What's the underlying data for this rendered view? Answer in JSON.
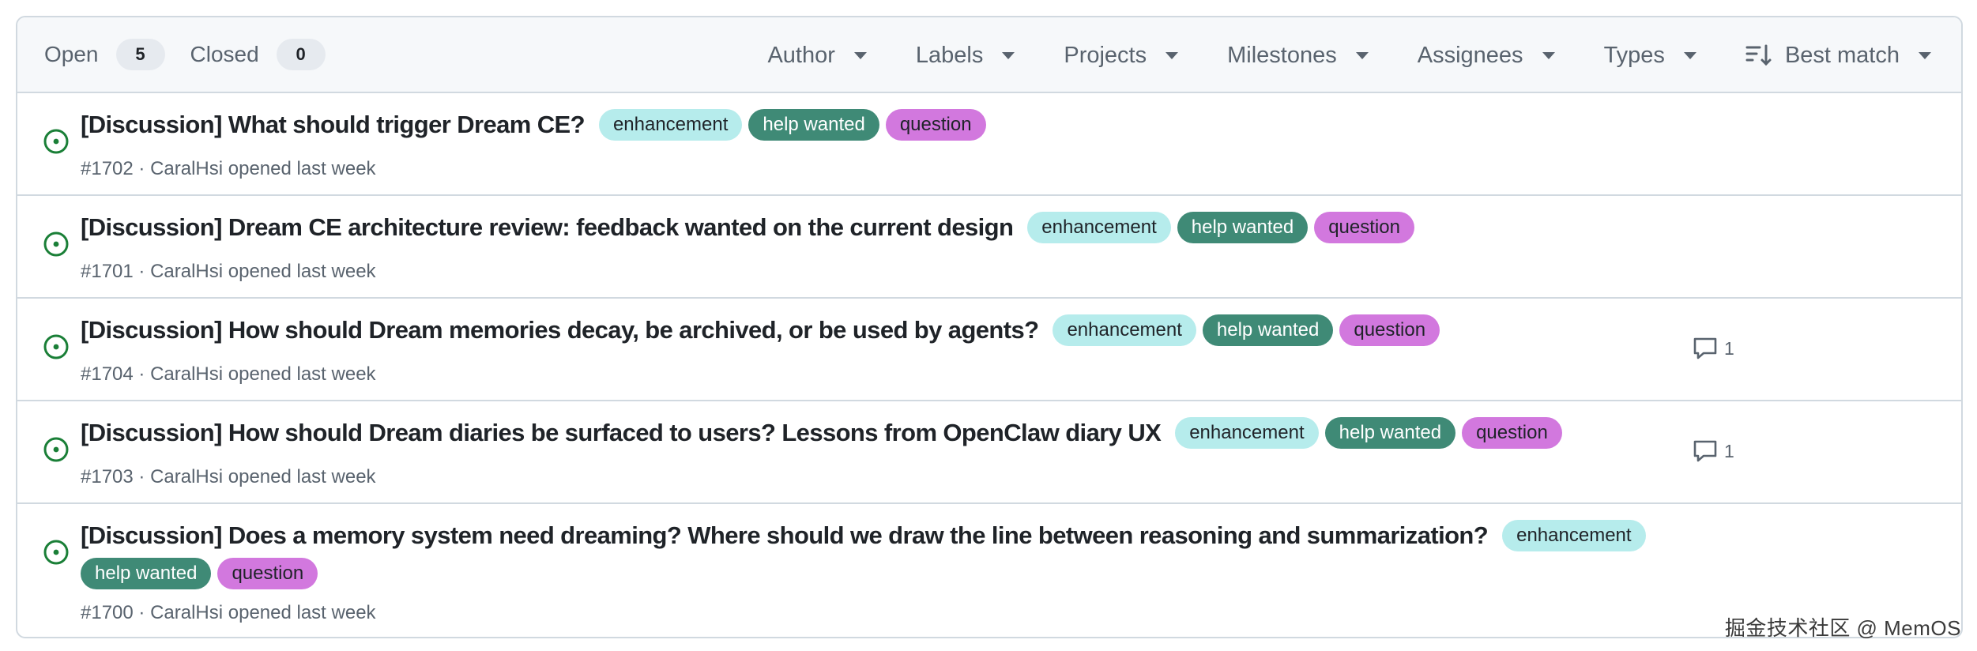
{
  "header": {
    "open_label": "Open",
    "open_count": "5",
    "closed_label": "Closed",
    "closed_count": "0",
    "filters": [
      "Author",
      "Labels",
      "Projects",
      "Milestones",
      "Assignees",
      "Types"
    ],
    "sort_label": "Best match"
  },
  "labels": {
    "enhancement": "enhancement",
    "help_wanted": "help wanted",
    "question": "question"
  },
  "label_colors": {
    "enhancement_bg": "#b6ecec",
    "help_wanted_bg": "#3f8a76",
    "question_bg": "#d278de"
  },
  "issues": [
    {
      "title": "[Discussion] What should trigger Dream CE?",
      "meta": "#1702 · CaralHsi opened last week",
      "comments": ""
    },
    {
      "title": "[Discussion] Dream CE architecture review: feedback wanted on the current design",
      "meta": "#1701 · CaralHsi opened last week",
      "comments": ""
    },
    {
      "title": "[Discussion] How should Dream memories decay, be archived, or be used by agents?",
      "meta": "#1704 · CaralHsi opened last week",
      "comments": "1"
    },
    {
      "title": "[Discussion] How should Dream diaries be surfaced to users? Lessons from OpenClaw diary UX",
      "meta": "#1703 · CaralHsi opened last week",
      "comments": "1"
    },
    {
      "title": "[Discussion] Does a memory system need dreaming? Where should we draw the line between reasoning and summarization?",
      "meta": "#1700 · CaralHsi opened last week",
      "comments": ""
    }
  ],
  "watermark": "掘金技术社区 @ MemOS"
}
